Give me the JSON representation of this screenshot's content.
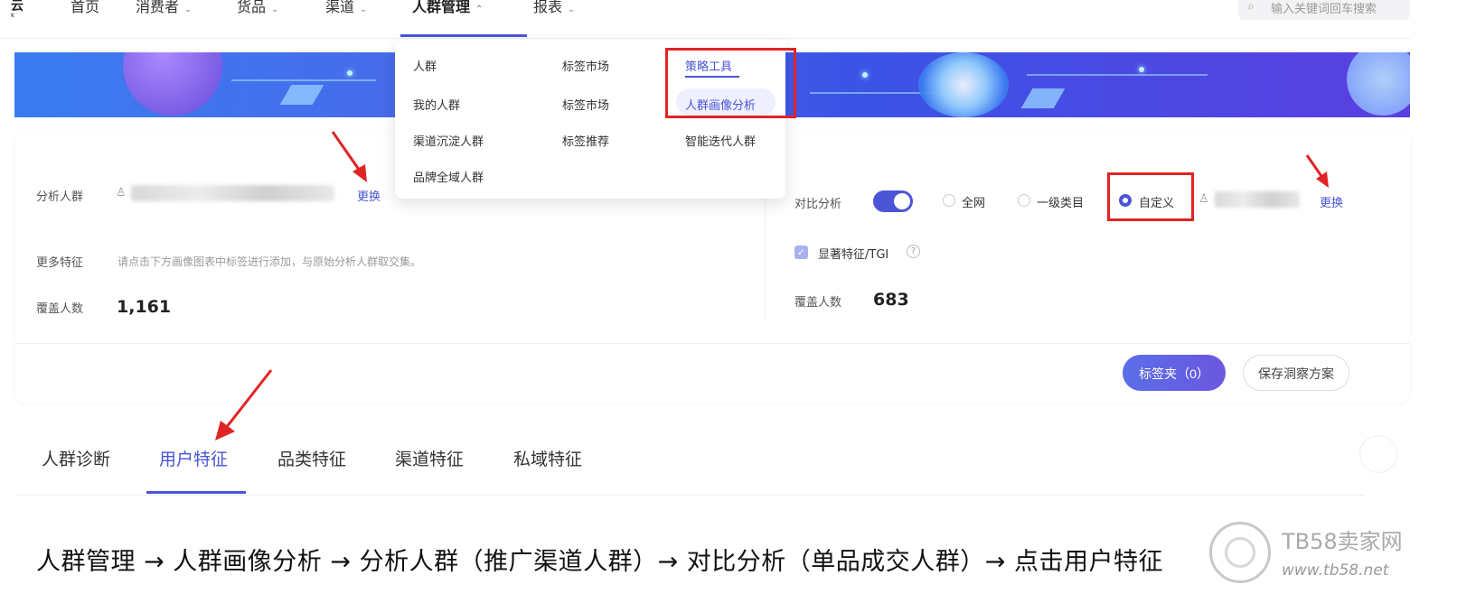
{
  "nav": {
    "logo": "云",
    "logo_sub": "K",
    "items": [
      {
        "label": "首页",
        "chevron": false
      },
      {
        "label": "消费者",
        "chevron": true
      },
      {
        "label": "货品",
        "chevron": true
      },
      {
        "label": "渠道",
        "chevron": true
      },
      {
        "label": "人群管理",
        "chevron": true
      },
      {
        "label": "报表",
        "chevron": true
      }
    ],
    "chevron_down": "⌄",
    "chevron_up": "⌃",
    "search_placeholder": "输入关键词回车搜索"
  },
  "dropdown": {
    "col1": [
      "人群",
      "我的人群",
      "渠道沉淀人群",
      "品牌全域人群"
    ],
    "col2": [
      "标签市场",
      "标签市场",
      "标签推荐"
    ],
    "col3": [
      "策略工具",
      "人群画像分析",
      "智能迭代人群"
    ]
  },
  "analysis": {
    "analysis_label": "分析人群",
    "change_link": "更换",
    "more_features_label": "更多特征",
    "more_features_hint": "请点击下方画像图表中标签进行添加，与原始分析人群取交集。",
    "coverage_label": "覆盖人数",
    "coverage_value": "1,161"
  },
  "compare": {
    "label": "对比分析",
    "toggle_on": true,
    "options": [
      "全网",
      "一级类目",
      "自定义"
    ],
    "selected": "自定义",
    "change_link": "更换",
    "significant_label": "显著特征/TGI",
    "help_icon": "?",
    "coverage_label": "覆盖人数",
    "coverage_value": "683"
  },
  "buttons": {
    "tag_folder": "标签夹（0）",
    "save_plan": "保存洞察方案"
  },
  "tabs": [
    "人群诊断",
    "用户特征",
    "品类特征",
    "渠道特征",
    "私域特征"
  ],
  "active_tab": "用户特征",
  "caption": "人群管理 → 人群画像分析 → 分析人群（推广渠道人群）→ 对比分析（单品成交人群）→ 点击用户特征",
  "watermark": {
    "title": "TB58卖家网",
    "url": "www.tb58.net"
  },
  "colors": {
    "accent": "#4a55d6",
    "annotation_red": "#e02424"
  }
}
